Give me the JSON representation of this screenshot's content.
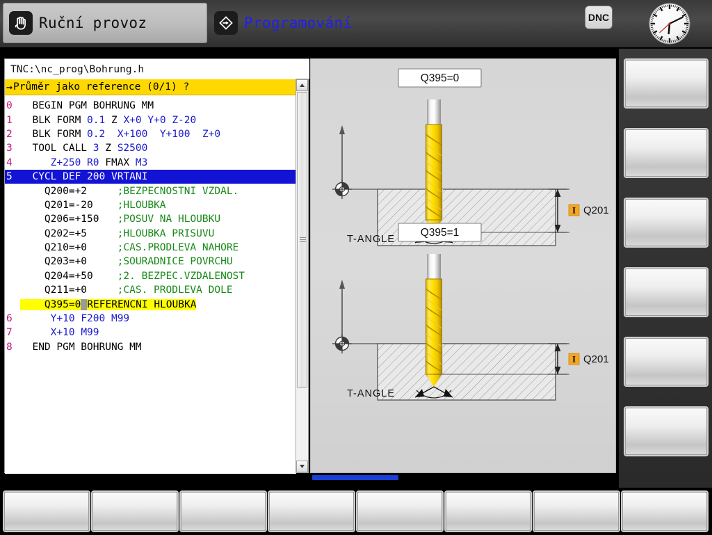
{
  "header": {
    "modes": [
      {
        "label": "Ruční provoz",
        "icon": "hand-icon",
        "active": false
      },
      {
        "label": "Programování",
        "icon": "program-diamond-icon",
        "active": true
      }
    ],
    "dnc_label": "DNC",
    "clock": {
      "name": "analog-clock",
      "hour": 6,
      "minute": 10,
      "second": 38
    }
  },
  "program": {
    "path": "TNC:\\nc_prog\\Bohrung.h",
    "prompt_arrow": "→",
    "prompt": "Průměr jako reference (0/1) ?",
    "lines": [
      {
        "num": "0",
        "segments": [
          {
            "t": "  BEGIN PGM BOHRUNG MM",
            "c": "plain"
          }
        ]
      },
      {
        "num": "1",
        "segments": [
          {
            "t": "  BLK FORM ",
            "c": "plain"
          },
          {
            "t": "0.1",
            "c": "num"
          },
          {
            "t": " Z ",
            "c": "plain"
          },
          {
            "t": "X+0",
            "c": "num"
          },
          {
            "t": " ",
            "c": "plain"
          },
          {
            "t": "Y+0",
            "c": "num"
          },
          {
            "t": " ",
            "c": "plain"
          },
          {
            "t": "Z-20",
            "c": "num"
          }
        ]
      },
      {
        "num": "2",
        "segments": [
          {
            "t": "  BLK FORM ",
            "c": "plain"
          },
          {
            "t": "0.2",
            "c": "num"
          },
          {
            "t": "  ",
            "c": "plain"
          },
          {
            "t": "X+100",
            "c": "num"
          },
          {
            "t": "  ",
            "c": "plain"
          },
          {
            "t": "Y+100",
            "c": "num"
          },
          {
            "t": "  ",
            "c": "plain"
          },
          {
            "t": "Z+0",
            "c": "num"
          }
        ]
      },
      {
        "num": "3",
        "segments": [
          {
            "t": "  TOOL CALL ",
            "c": "plain"
          },
          {
            "t": "3",
            "c": "num"
          },
          {
            "t": " Z ",
            "c": "plain"
          },
          {
            "t": "S2500",
            "c": "num"
          }
        ]
      },
      {
        "num": "4",
        "segments": [
          {
            "t": "     ",
            "c": "plain"
          },
          {
            "t": "Z+250",
            "c": "num"
          },
          {
            "t": " ",
            "c": "plain"
          },
          {
            "t": "R0",
            "c": "num"
          },
          {
            "t": " FMAX ",
            "c": "plain"
          },
          {
            "t": "M3",
            "c": "num"
          }
        ]
      },
      {
        "num": "5",
        "selected": true,
        "segments": [
          {
            "t": "  CYCL DEF ",
            "c": "plain"
          },
          {
            "t": "200",
            "c": "num"
          },
          {
            "t": " VRTANI",
            "c": "plain"
          }
        ]
      },
      {
        "num": "",
        "segments": [
          {
            "t": "    Q200=+2",
            "c": "plain"
          },
          {
            "t": "     ;BEZPECNOSTNI VZDAL.",
            "c": "cmt"
          }
        ]
      },
      {
        "num": "",
        "segments": [
          {
            "t": "    Q201=-20",
            "c": "plain"
          },
          {
            "t": "    ;HLOUBKA",
            "c": "cmt"
          }
        ]
      },
      {
        "num": "",
        "segments": [
          {
            "t": "    Q206=+150",
            "c": "plain"
          },
          {
            "t": "   ;POSUV NA HLOUBKU",
            "c": "cmt"
          }
        ]
      },
      {
        "num": "",
        "segments": [
          {
            "t": "    Q202=+5",
            "c": "plain"
          },
          {
            "t": "     ;HLOUBKA PRISUVU",
            "c": "cmt"
          }
        ]
      },
      {
        "num": "",
        "segments": [
          {
            "t": "    Q210=+0",
            "c": "plain"
          },
          {
            "t": "     ;CAS.PRODLEVA NAHORE",
            "c": "cmt"
          }
        ]
      },
      {
        "num": "",
        "segments": [
          {
            "t": "    Q203=+0",
            "c": "plain"
          },
          {
            "t": "     ;SOURADNICE POVRCHU",
            "c": "cmt"
          }
        ]
      },
      {
        "num": "",
        "segments": [
          {
            "t": "    Q204=+50",
            "c": "plain"
          },
          {
            "t": "    ;2. BEZPEC.VZDALENOST",
            "c": "cmt"
          }
        ]
      },
      {
        "num": "",
        "segments": [
          {
            "t": "    Q211=+0",
            "c": "plain"
          },
          {
            "t": "     ;CAS. PRODLEVA DOLE",
            "c": "cmt"
          }
        ]
      },
      {
        "num": "",
        "editing": true,
        "segments": [
          {
            "t": "    Q395=0",
            "c": "plain"
          },
          {
            "t": ";",
            "c": "cursor"
          },
          {
            "t": "REFERENCNI HLOUBKA",
            "c": "plain"
          }
        ]
      },
      {
        "num": "6",
        "segments": [
          {
            "t": "     ",
            "c": "plain"
          },
          {
            "t": "Y+10",
            "c": "num"
          },
          {
            "t": " ",
            "c": "plain"
          },
          {
            "t": "F200",
            "c": "num"
          },
          {
            "t": " ",
            "c": "plain"
          },
          {
            "t": "M99",
            "c": "num"
          }
        ]
      },
      {
        "num": "7",
        "segments": [
          {
            "t": "     ",
            "c": "plain"
          },
          {
            "t": "X+10",
            "c": "num"
          },
          {
            "t": " ",
            "c": "plain"
          },
          {
            "t": "M99",
            "c": "num"
          }
        ]
      },
      {
        "num": "8",
        "segments": [
          {
            "t": "  END PGM BOHRUNG MM",
            "c": "plain"
          }
        ]
      }
    ]
  },
  "scrollbar": {
    "up_arrow": "▲",
    "down_arrow": "▼",
    "name": "program-vertical-scrollbar"
  },
  "graphics": {
    "name": "cycle-200-help-graphic",
    "diagrams": [
      {
        "id": "q395-0",
        "title": "Q395=0",
        "tool_angle_label": "T-ANGLE",
        "depth_label": "Q201",
        "depth_badge": "I",
        "depth_ref": "tool-tip"
      },
      {
        "id": "q395-1",
        "title": "Q395=1",
        "tool_angle_label": "T-ANGLE",
        "depth_label": "Q201",
        "depth_badge": "I",
        "depth_ref": "tool-diameter"
      }
    ]
  },
  "softkeys": {
    "vertical": [
      {
        "label": ""
      },
      {
        "label": ""
      },
      {
        "label": ""
      },
      {
        "label": ""
      },
      {
        "label": ""
      },
      {
        "label": ""
      }
    ],
    "horizontal": [
      {
        "label": ""
      },
      {
        "label": ""
      },
      {
        "label": ""
      },
      {
        "label": ""
      },
      {
        "label": ""
      },
      {
        "label": ""
      },
      {
        "label": ""
      },
      {
        "label": ""
      }
    ]
  },
  "colors": {
    "prompt_yellow": "#ffd800",
    "selected_blue": "#1313d6",
    "comment_green": "#188a18",
    "value_blue": "#1a1ad0",
    "line_number_magenta": "#c71585",
    "badge_orange": "#f5a623",
    "tool_yellow": "#f7d600",
    "progress_blue": "#1a3fd6"
  }
}
